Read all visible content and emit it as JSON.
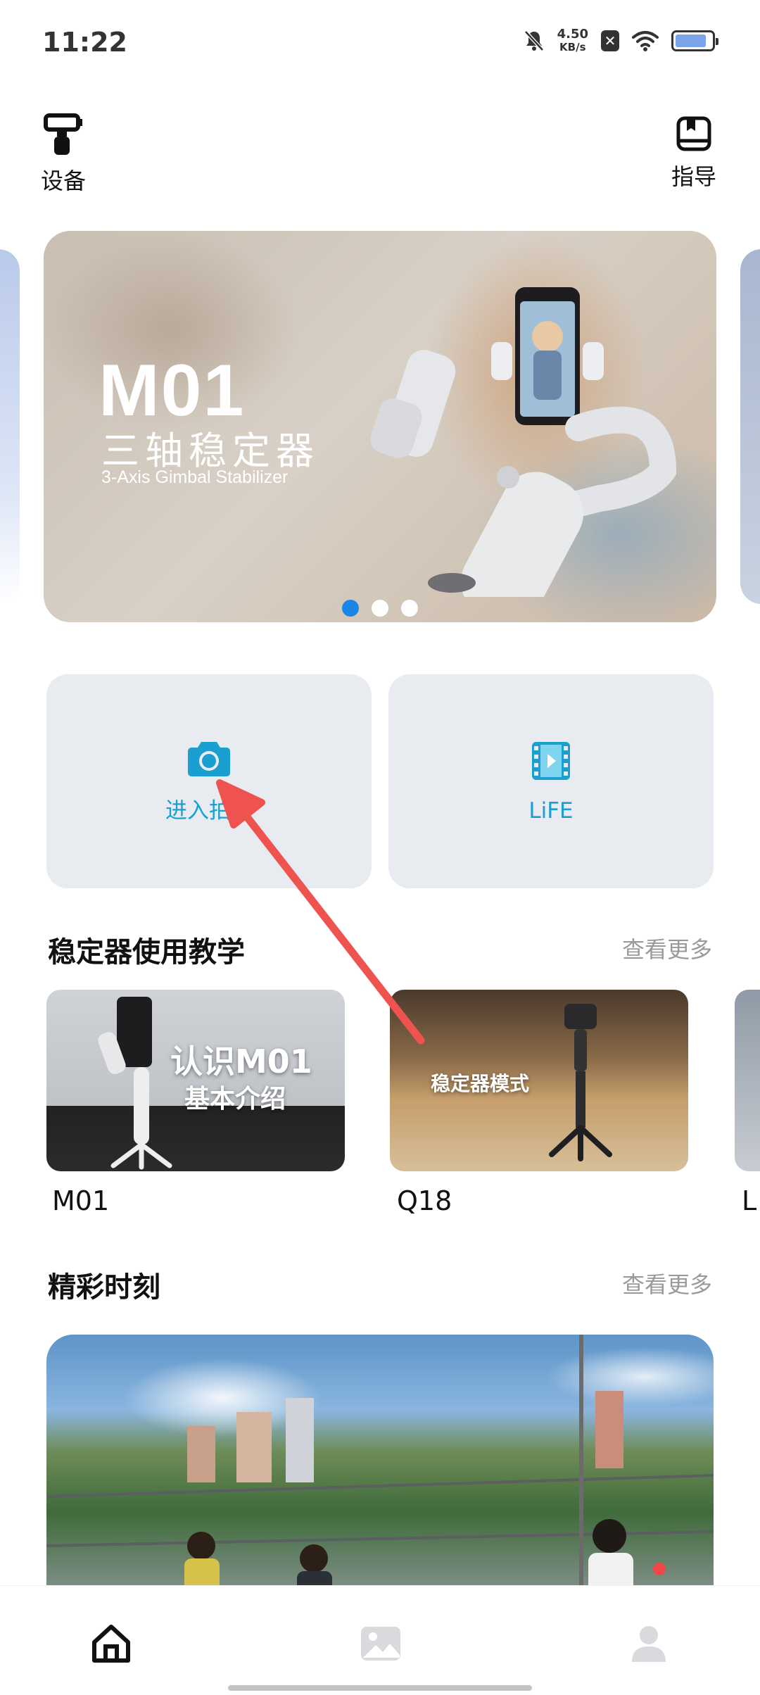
{
  "status_bar": {
    "time": "11:22",
    "net_speed_value": "4.50",
    "net_speed_unit": "KB/s",
    "battery_level": 0.85
  },
  "header": {
    "device_label": "设备",
    "guide_label": "指导"
  },
  "carousel": {
    "title": "M01",
    "subtitle": "三轴稳定器",
    "subtitle_en": "3-Axis Gimbal Stabilizer",
    "page_count": 3,
    "active_index": 0
  },
  "actions": {
    "camera_label": "进入拍摄",
    "life_label": "LiFE"
  },
  "tutorials": {
    "title": "稳定器使用教学",
    "more": "查看更多",
    "items": [
      {
        "name": "M01",
        "overlay_line1": "认识M01",
        "overlay_line2": "基本介绍"
      },
      {
        "name": "Q18",
        "overlay_line1": "稳定器模式"
      },
      {
        "name": "L"
      }
    ]
  },
  "moments": {
    "title": "精彩时刻",
    "more": "查看更多"
  },
  "bottom_nav": {
    "items": [
      "home-icon",
      "gallery-icon",
      "profile-icon"
    ],
    "active": "home-icon",
    "profile_badge": true
  },
  "colors": {
    "accent": "#1a9fd0",
    "dot_active": "#1a86e8",
    "annotation_arrow": "#ef5350",
    "badge": "#f04848"
  }
}
